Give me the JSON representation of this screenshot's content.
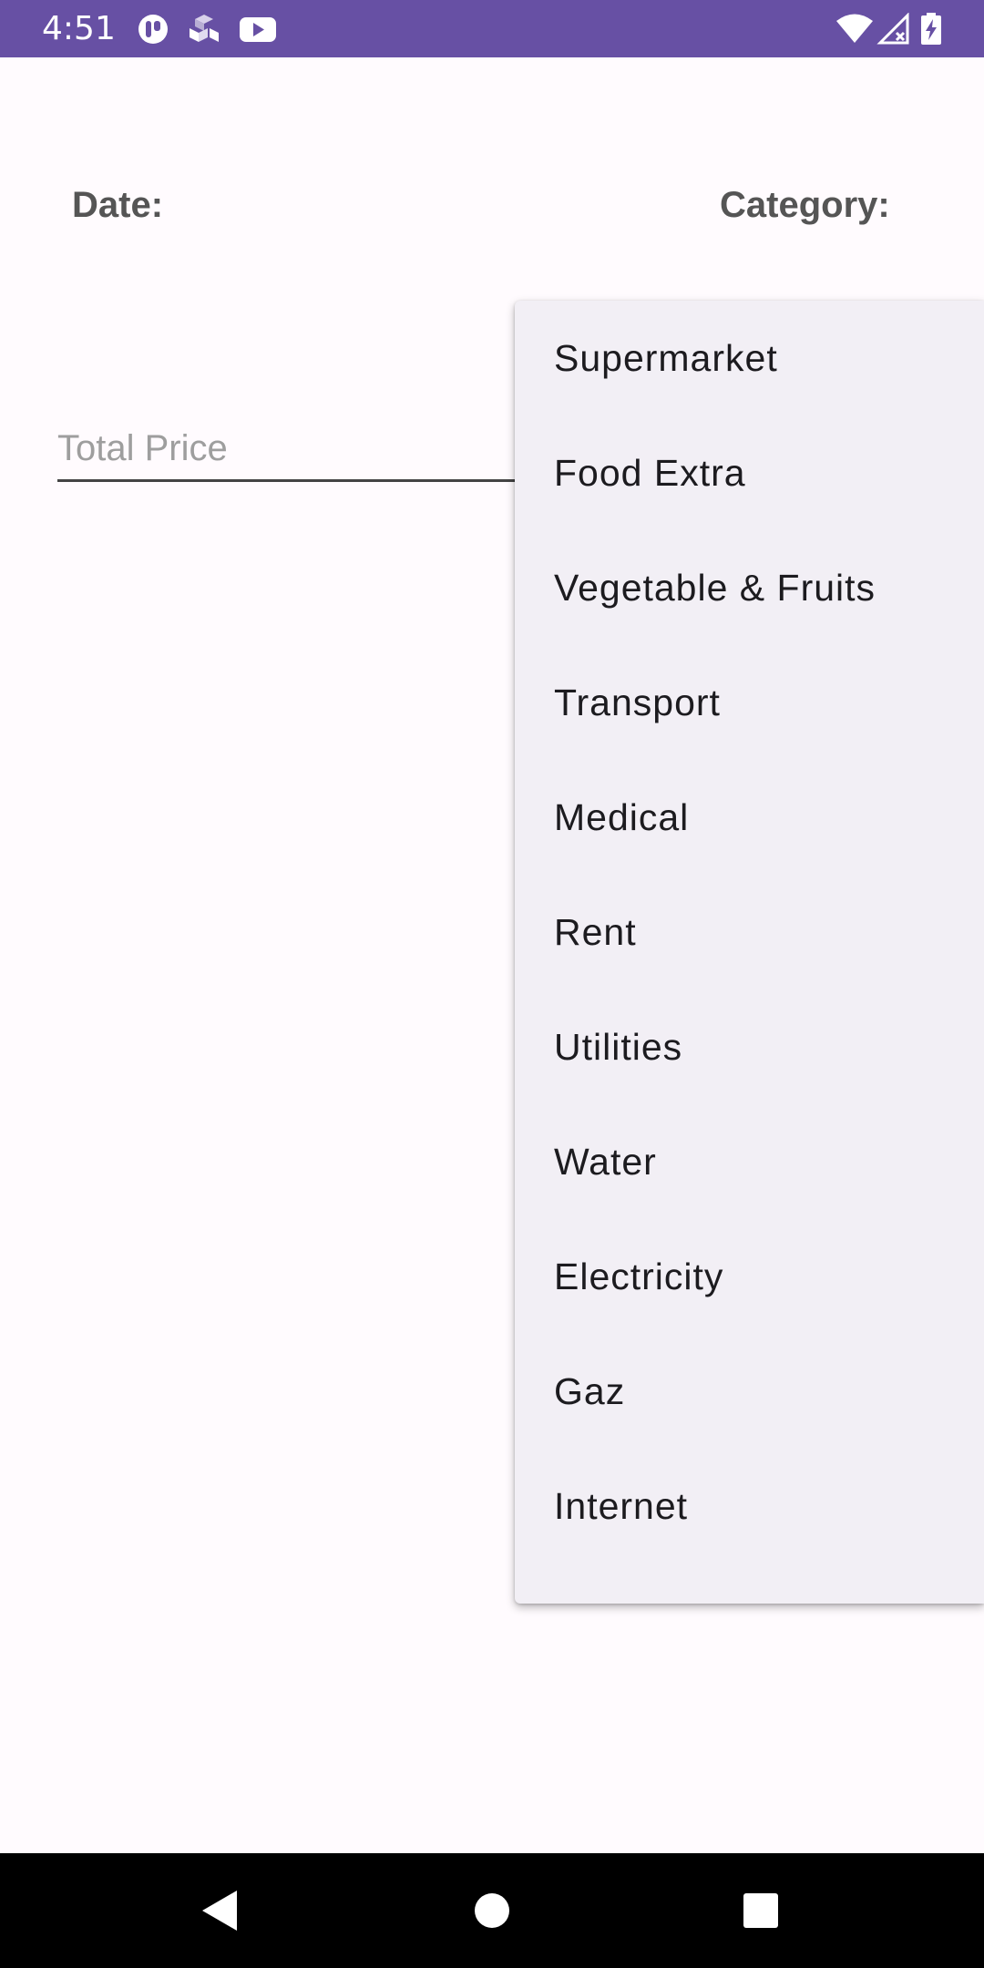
{
  "status_bar": {
    "time": "4:51",
    "background_color": "#6750a4",
    "left_icons": [
      "pill-icon",
      "game-dice-icon",
      "youtube-icon"
    ],
    "right_icons": [
      "wifi-icon",
      "cellular-signal-off-icon",
      "battery-charging-icon"
    ]
  },
  "form": {
    "date_label": "Date:",
    "category_label": "Category:",
    "total_price": {
      "value": "",
      "placeholder": "Total Price"
    }
  },
  "category_dropdown": {
    "expanded": true,
    "background_color": "#f2eff5",
    "items": [
      {
        "label": "Supermarket"
      },
      {
        "label": "Food Extra"
      },
      {
        "label": "Vegetable & Fruits"
      },
      {
        "label": "Transport"
      },
      {
        "label": "Medical"
      },
      {
        "label": "Rent"
      },
      {
        "label": "Utilities"
      },
      {
        "label": "Water"
      },
      {
        "label": "Electricity"
      },
      {
        "label": "Gaz"
      },
      {
        "label": "Internet"
      }
    ]
  },
  "nav_bar": {
    "buttons": [
      "back-icon",
      "home-icon",
      "recents-icon"
    ]
  }
}
